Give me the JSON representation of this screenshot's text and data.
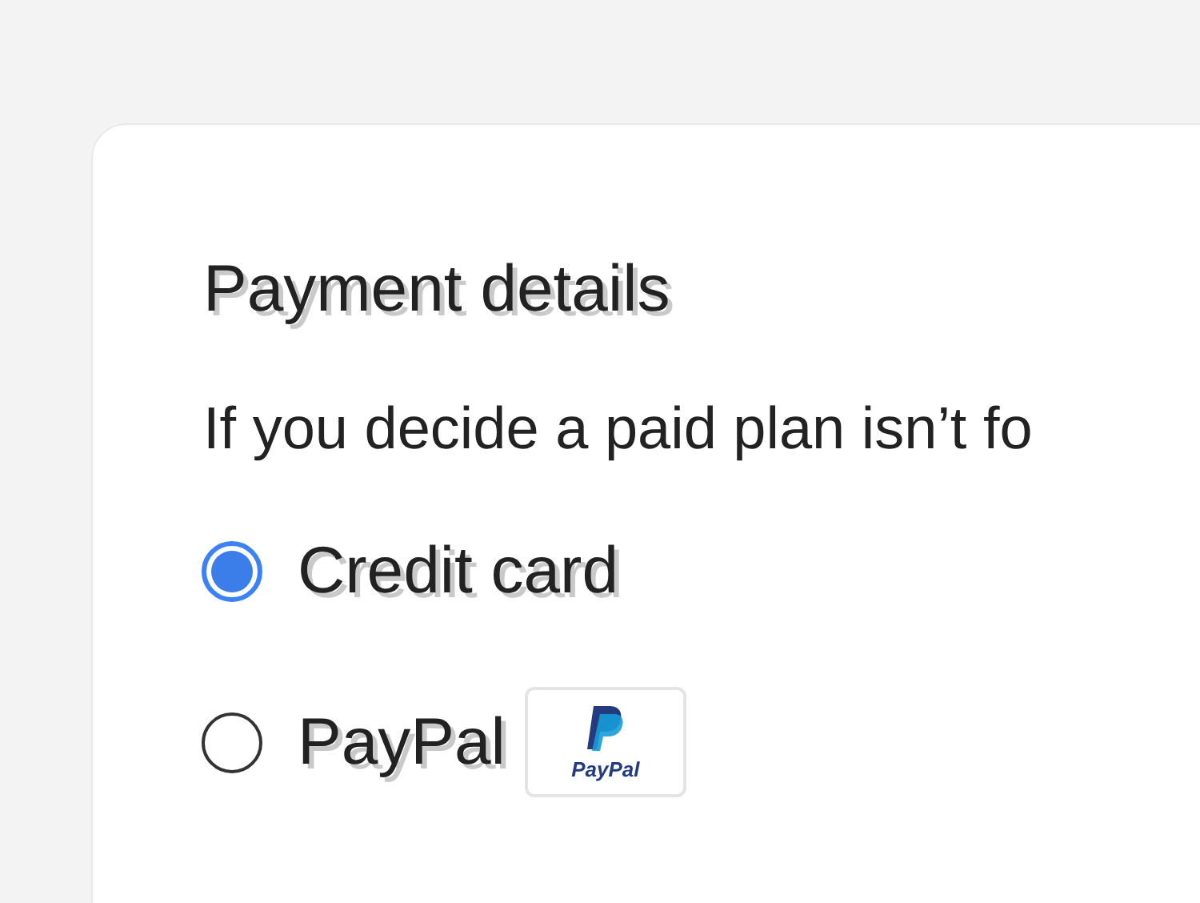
{
  "title": "Payment details",
  "description": "If you decide a paid plan isn’t fo",
  "payment_methods": [
    {
      "label": "Credit card",
      "selected": true,
      "kind": "plain"
    },
    {
      "label": "PayPal",
      "selected": false,
      "kind": "paypal",
      "logo_text": "PayPal"
    }
  ]
}
